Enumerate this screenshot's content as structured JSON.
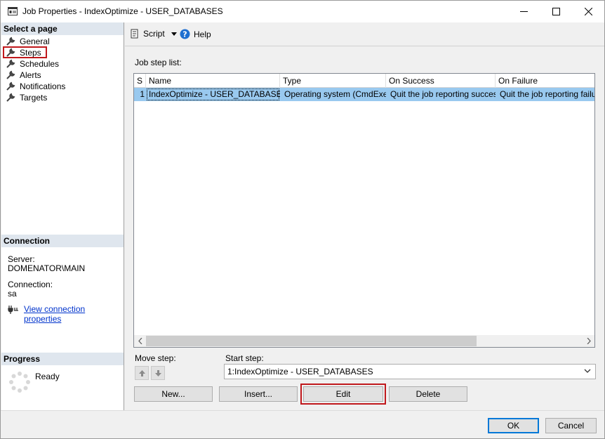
{
  "window": {
    "title": "Job Properties - IndexOptimize - USER_DATABASES"
  },
  "left_panel": {
    "select_page_header": "Select a page",
    "pages": [
      {
        "label": "General"
      },
      {
        "label": "Steps"
      },
      {
        "label": "Schedules"
      },
      {
        "label": "Alerts"
      },
      {
        "label": "Notifications"
      },
      {
        "label": "Targets"
      }
    ],
    "selected_page": "Steps",
    "connection": {
      "header": "Connection",
      "server_label": "Server:",
      "server_value": "DOMENATOR\\MAIN",
      "connection_label": "Connection:",
      "connection_value": "sa",
      "view_link": "View connection properties"
    },
    "progress": {
      "header": "Progress",
      "status": "Ready"
    }
  },
  "toolbar": {
    "script_label": "Script",
    "help_label": "Help"
  },
  "steps": {
    "list_label": "Job step list:",
    "columns": [
      "S",
      "Name",
      "Type",
      "On Success",
      "On Failure"
    ],
    "rows": [
      {
        "step": "1",
        "name": "IndexOptimize - USER_DATABASES",
        "type": "Operating system (CmdExec)",
        "on_success": "Quit the job reporting success",
        "on_failure": "Quit the job reporting failure"
      }
    ],
    "move_step_label": "Move step:",
    "start_step_label": "Start step:",
    "start_step_value": "1:IndexOptimize - USER_DATABASES",
    "buttons": {
      "new": "New...",
      "insert": "Insert...",
      "edit": "Edit",
      "delete": "Delete"
    }
  },
  "footer": {
    "ok": "OK",
    "cancel": "Cancel"
  },
  "colors": {
    "selection": "#99c9ef",
    "highlight_frame": "#c0181c",
    "section_header": "#dfe6ee",
    "link": "#0033cc",
    "default_button_border": "#0078d7"
  }
}
